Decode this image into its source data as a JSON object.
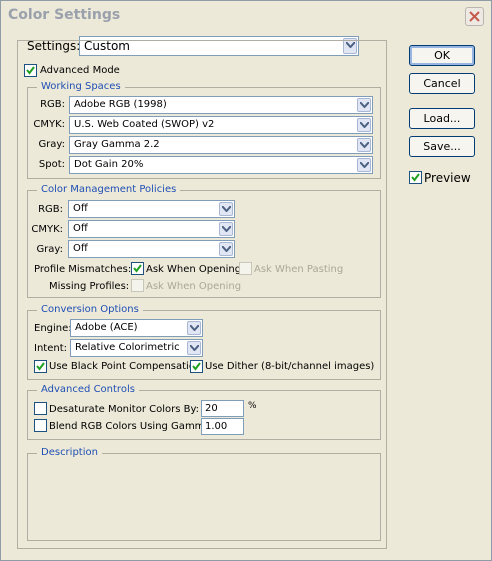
{
  "window": {
    "title": "Color Settings"
  },
  "settings": {
    "label": "Settings:",
    "value": "Custom"
  },
  "advanced_mode": {
    "label": "Advanced Mode",
    "checked": true
  },
  "working_spaces": {
    "title": "Working Spaces",
    "rgb": {
      "label": "RGB:",
      "value": "Adobe RGB (1998)"
    },
    "cmyk": {
      "label": "CMYK:",
      "value": "U.S. Web Coated (SWOP) v2"
    },
    "gray": {
      "label": "Gray:",
      "value": "Gray Gamma 2.2"
    },
    "spot": {
      "label": "Spot:",
      "value": "Dot Gain 20%"
    }
  },
  "policies": {
    "title": "Color Management Policies",
    "rgb": {
      "label": "RGB:",
      "value": "Off"
    },
    "cmyk": {
      "label": "CMYK:",
      "value": "Off"
    },
    "gray": {
      "label": "Gray:",
      "value": "Off"
    },
    "profile_mismatches_label": "Profile Mismatches:",
    "ask_when_opening": {
      "label": "Ask When Opening",
      "checked": true
    },
    "ask_when_pasting": {
      "label": "Ask When Pasting",
      "checked": false,
      "disabled": true
    },
    "missing_profiles_label": "Missing Profiles:",
    "missing_ask_when_opening": {
      "label": "Ask When Opening",
      "checked": false,
      "disabled": true
    }
  },
  "conversion": {
    "title": "Conversion Options",
    "engine": {
      "label": "Engine:",
      "value": "Adobe (ACE)"
    },
    "intent": {
      "label": "Intent:",
      "value": "Relative Colorimetric"
    },
    "black_point": {
      "label": "Use Black Point Compensation",
      "checked": true
    },
    "dither": {
      "label": "Use Dither (8-bit/channel images)",
      "checked": true
    }
  },
  "advanced_controls": {
    "title": "Advanced Controls",
    "desaturate": {
      "label": "Desaturate Monitor Colors By:",
      "value": "20",
      "unit": "%",
      "checked": false
    },
    "blend": {
      "label": "Blend RGB Colors Using Gamma:",
      "value": "1.00",
      "checked": false
    }
  },
  "description": {
    "title": "Description"
  },
  "buttons": {
    "ok": "OK",
    "cancel": "Cancel",
    "load": "Load...",
    "save": "Save..."
  },
  "preview": {
    "label": "Preview",
    "checked": true
  },
  "colors": {
    "accent": "#1f4fb4",
    "face": "#ece9d8",
    "check": "#21a121"
  }
}
